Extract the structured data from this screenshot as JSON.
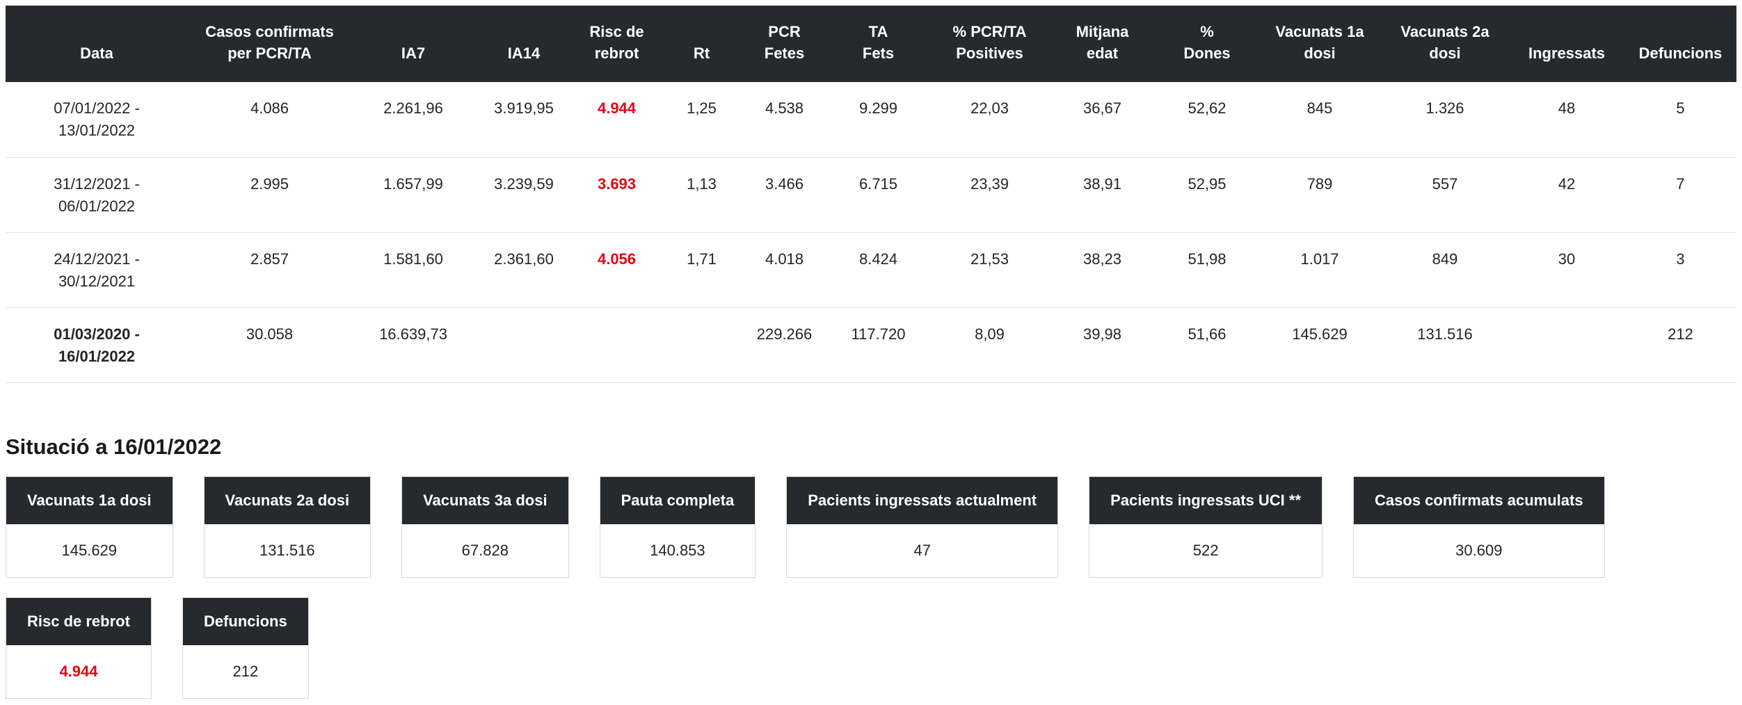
{
  "colors": {
    "header_dark": "#262a2e",
    "accent_red": "#e30613",
    "total_row_gray": "#d2d2d2"
  },
  "table": {
    "columns": [
      {
        "line1": "Data",
        "line2": ""
      },
      {
        "line1": "Casos confirmats",
        "line2": "per PCR/TA"
      },
      {
        "line1": "IA7",
        "line2": ""
      },
      {
        "line1": "IA14",
        "line2": ""
      },
      {
        "line1": "Risc de",
        "line2": "rebrot"
      },
      {
        "line1": "Rt",
        "line2": ""
      },
      {
        "line1": "PCR",
        "line2": "Fetes"
      },
      {
        "line1": "TA",
        "line2": "Fets"
      },
      {
        "line1": "% PCR/TA",
        "line2": "Positives"
      },
      {
        "line1": "Mitjana",
        "line2": "edat"
      },
      {
        "line1": "%",
        "line2": "Dones"
      },
      {
        "line1": "Vacunats 1a",
        "line2": "dosi"
      },
      {
        "line1": "Vacunats 2a",
        "line2": "dosi"
      },
      {
        "line1": "Ingressats",
        "line2": ""
      },
      {
        "line1": "Defuncions",
        "line2": ""
      }
    ],
    "rows": [
      {
        "date_line1": "07/01/2022 -",
        "date_line2": "13/01/2022",
        "values": [
          "4.086",
          "2.261,96",
          "3.919,95",
          "4.944",
          "1,25",
          "4.538",
          "9.299",
          "22,03",
          "36,67",
          "52,62",
          "845",
          "1.326",
          "48",
          "5"
        ]
      },
      {
        "date_line1": "31/12/2021 -",
        "date_line2": "06/01/2022",
        "values": [
          "2.995",
          "1.657,99",
          "3.239,59",
          "3.693",
          "1,13",
          "3.466",
          "6.715",
          "23,39",
          "38,91",
          "52,95",
          "789",
          "557",
          "42",
          "7"
        ]
      },
      {
        "date_line1": "24/12/2021 -",
        "date_line2": "30/12/2021",
        "values": [
          "2.857",
          "1.581,60",
          "2.361,60",
          "4.056",
          "1,71",
          "4.018",
          "8.424",
          "21,53",
          "38,23",
          "51,98",
          "1.017",
          "849",
          "30",
          "3"
        ]
      },
      {
        "date_line1": "01/03/2020 -",
        "date_line2": "16/01/2022",
        "values": [
          "30.058",
          "16.639,73",
          "",
          "",
          "",
          "229.266",
          "117.720",
          "8,09",
          "39,98",
          "51,66",
          "145.629",
          "131.516",
          "",
          "212"
        ]
      }
    ]
  },
  "situation": {
    "title": "Situació a 16/01/2022",
    "cards": [
      {
        "label": "Vacunats 1a dosi",
        "value": "145.629"
      },
      {
        "label": "Vacunats 2a dosi",
        "value": "131.516"
      },
      {
        "label": "Vacunats 3a dosi",
        "value": "67.828"
      },
      {
        "label": "Pauta completa",
        "value": "140.853"
      },
      {
        "label": "Pacients ingressats actualment",
        "value": "47"
      },
      {
        "label": "Pacients ingressats UCI **",
        "value": "522"
      },
      {
        "label": "Casos confirmats acumulats",
        "value": "30.609"
      },
      {
        "label": "Risc de rebrot",
        "value": "4.944"
      },
      {
        "label": "Defuncions",
        "value": "212"
      }
    ]
  }
}
